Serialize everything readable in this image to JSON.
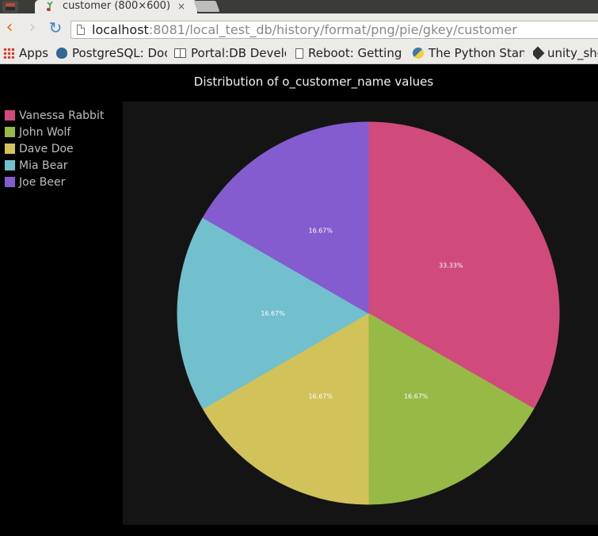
{
  "browser": {
    "tab_title": "customer (800×600)",
    "tab_close": "×",
    "url_host": "localhost",
    "url_rest": ":8081/local_test_db/history/format/png/pie/gkey/customer",
    "bookmarks": [
      {
        "label": "Apps",
        "icon": "apps-grid-icon"
      },
      {
        "label": "PostgreSQL: Doc",
        "icon": "postgresql-elephant-icon"
      },
      {
        "label": "Portal:DB Develo",
        "icon": "book-icon"
      },
      {
        "label": "Reboot: Getting S",
        "icon": "page-icon"
      },
      {
        "label": "The Python Stanc",
        "icon": "python-icon"
      },
      {
        "label": "unity_sho",
        "icon": "unity-icon"
      }
    ]
  },
  "chart_data": {
    "type": "pie",
    "title": "Distribution of o_customer_name values",
    "legend_position": "top-left",
    "slices": [
      {
        "label": "Vanessa Rabbit",
        "value": 33.33,
        "display": "33.33%",
        "color": "#d04b7b"
      },
      {
        "label": "John Wolf",
        "value": 16.67,
        "display": "16.67%",
        "color": "#97b946"
      },
      {
        "label": "Dave Doe",
        "value": 16.67,
        "display": "16.67%",
        "color": "#d1c25a"
      },
      {
        "label": "Mia Bear",
        "value": 16.67,
        "display": "16.67%",
        "color": "#72bfcd"
      },
      {
        "label": "Joe Beer",
        "value": 16.67,
        "display": "16.67%",
        "color": "#845ccf"
      }
    ]
  }
}
